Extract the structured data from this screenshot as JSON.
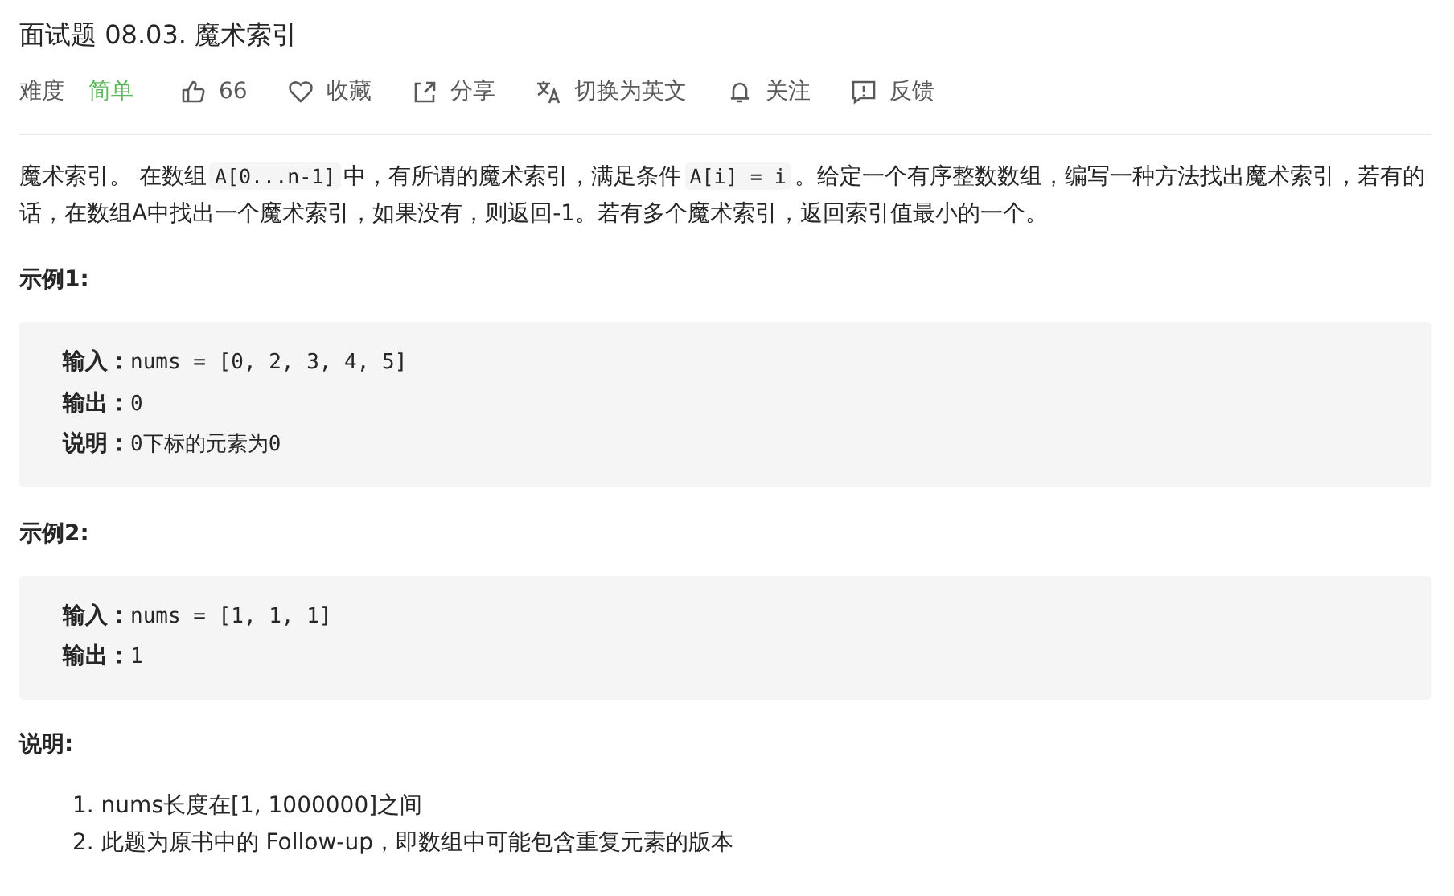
{
  "title": "面试题 08.03. 魔术索引",
  "meta": {
    "difficulty_label": "难度",
    "difficulty": "简单",
    "actions": [
      {
        "kind": "like",
        "label": "66"
      },
      {
        "kind": "favorite",
        "label": "收藏"
      },
      {
        "kind": "share",
        "label": "分享"
      },
      {
        "kind": "translate",
        "label": "切换为英文"
      },
      {
        "kind": "follow",
        "label": "关注"
      },
      {
        "kind": "feedback",
        "label": "反馈"
      }
    ]
  },
  "description": [
    {
      "kind": "text",
      "text": "魔术索引。 在数组"
    },
    {
      "kind": "code",
      "text": "A[0...n-1]"
    },
    {
      "kind": "text",
      "text": "中，有所谓的魔术索引，满足条件"
    },
    {
      "kind": "code",
      "text": "A[i] = i"
    },
    {
      "kind": "text",
      "text": "。给定一个有序整数数组，编写一种方法找出魔术索引，若有的话，在数组A中找出一个魔术索引，如果没有，则返回-1。若有多个魔术索引，返回索引值最小的一个。"
    }
  ],
  "examples": [
    {
      "heading": "示例1:",
      "lines": [
        {
          "label": "输入：",
          "value": "nums = [0, 2, 3, 4, 5]"
        },
        {
          "label": "输出：",
          "value": "0"
        },
        {
          "label": "说明：",
          "value": "0下标的元素为0"
        }
      ]
    },
    {
      "heading": "示例2:",
      "lines": [
        {
          "label": "输入：",
          "value": "nums = [1, 1, 1]"
        },
        {
          "label": "输出：",
          "value": "1"
        }
      ]
    }
  ],
  "notes": {
    "heading": "说明:",
    "items": [
      {
        "number": "1.",
        "text": "nums长度在[1, 1000000]之间"
      },
      {
        "number": "2.",
        "text": "此题为原书中的 Follow-up，即数组中可能包含重复元素的版本"
      }
    ]
  }
}
